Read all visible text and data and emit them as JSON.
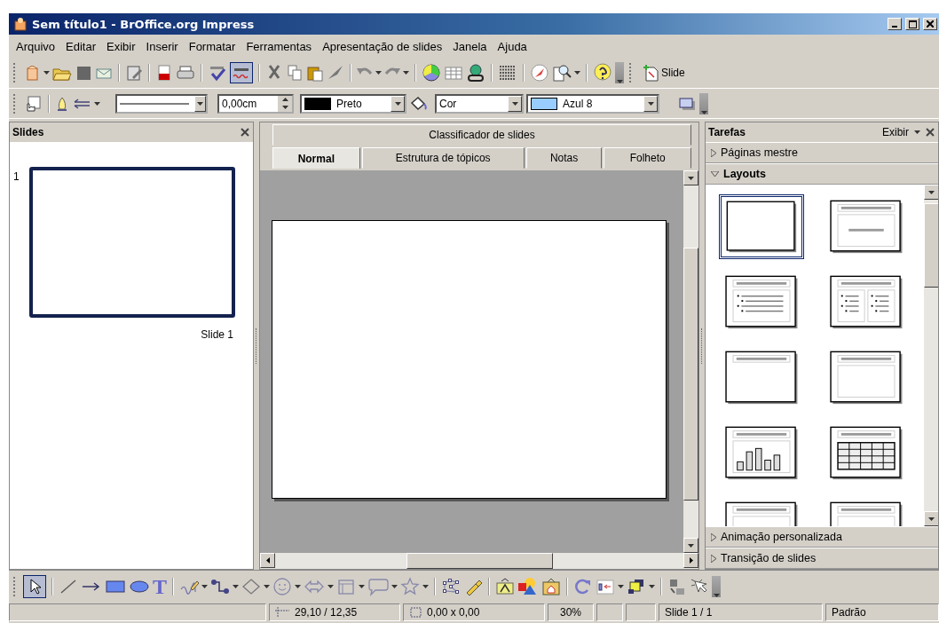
{
  "window": {
    "title": "Sem título1 - BrOffice.org Impress"
  },
  "menu": [
    "Arquivo",
    "Editar",
    "Exibir",
    "Inserir",
    "Formatar",
    "Ferramentas",
    "Apresentação de slides",
    "Janela",
    "Ajuda"
  ],
  "standard_toolbar": {
    "auto_spellcheck_on": true,
    "slide_button": "Slide"
  },
  "line_toolbar": {
    "line_width": "0,00cm",
    "line_color": {
      "name": "Preto",
      "color": "#000000"
    },
    "area_style": "Cor",
    "area_fill": {
      "name": "Azul 8",
      "color": "#99ccff"
    }
  },
  "slides_panel": {
    "title": "Slides",
    "slides": [
      {
        "number": "1",
        "label": "Slide 1",
        "selected": true
      }
    ]
  },
  "view_tabs": [
    [
      {
        "label": "Classificador de slides",
        "selected": false
      }
    ],
    [
      {
        "label": "Normal",
        "selected": true
      },
      {
        "label": "Estrutura de tópicos",
        "selected": false
      },
      {
        "label": "Notas",
        "selected": false
      },
      {
        "label": "Folheto",
        "selected": false
      }
    ]
  ],
  "tasks_panel": {
    "title": "Tarefas",
    "view_menu": "Exibir",
    "sections": [
      {
        "label": "Páginas mestre",
        "expanded": false
      },
      {
        "label": "Layouts",
        "expanded": true,
        "layouts": [
          {
            "kind": "blank",
            "selected": true
          },
          {
            "kind": "title-subtitle",
            "selected": false
          },
          {
            "kind": "title-bullets",
            "selected": false
          },
          {
            "kind": "title-two-bullets",
            "selected": false
          },
          {
            "kind": "title-only",
            "selected": false
          },
          {
            "kind": "title-box",
            "selected": false
          },
          {
            "kind": "title-chart",
            "selected": false
          },
          {
            "kind": "title-table",
            "selected": false
          },
          {
            "kind": "title-box",
            "selected": false
          },
          {
            "kind": "title-box",
            "selected": false
          }
        ]
      },
      {
        "label": "Animação personalizada",
        "expanded": false
      },
      {
        "label": "Transição de slides",
        "expanded": false
      }
    ]
  },
  "drawing_toolbar": {
    "select_on": true,
    "text_tool": "T"
  },
  "status_bar": {
    "position": "29,10 / 12,35",
    "size": "0,00 x 0,00",
    "zoom": "30%",
    "page": "Slide 1 / 1",
    "layout": "Padrão"
  }
}
